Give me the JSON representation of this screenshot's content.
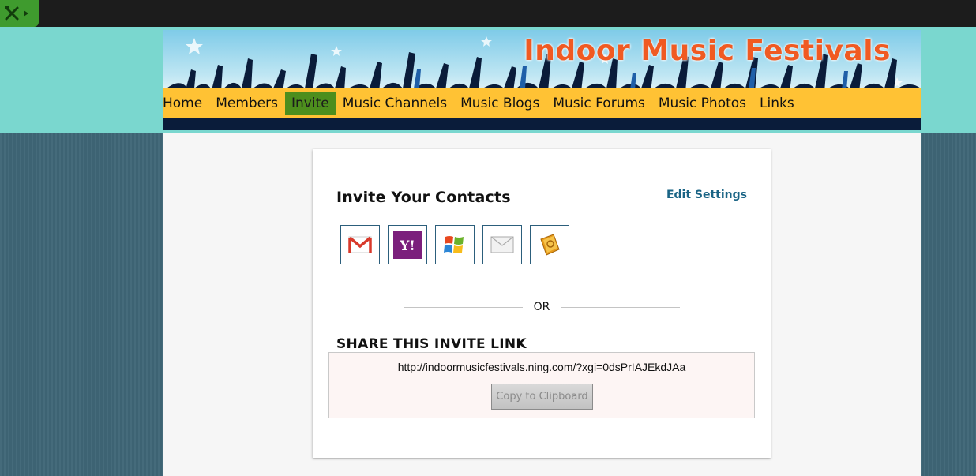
{
  "site": {
    "title": "Indoor Music Festivals"
  },
  "nav": {
    "items": [
      "Home",
      "Members",
      "Invite",
      "Music Channels",
      "Music Blogs",
      "Music Forums",
      "Music Photos",
      "Links"
    ],
    "active": "Invite"
  },
  "invite": {
    "heading": "Invite Your Contacts",
    "edit_settings": "Edit Settings",
    "providers": [
      "gmail-icon",
      "yahoo-icon",
      "windows-live-icon",
      "email-envelope-icon",
      "address-book-icon"
    ],
    "or_label": "OR",
    "share_title": "SHARE THIS INVITE LINK",
    "link": "http://indoormusicfestivals.ning.com/?xgi=0dsPrIAJEkdJAa",
    "copy_button": "Copy to Clipboard"
  },
  "colors": {
    "accent_nav": "#ffc234",
    "active_tab": "#4d8e1d",
    "title_orange": "#f05a22",
    "link_blue": "#1a6485",
    "page_band": "#7ad7cf"
  }
}
